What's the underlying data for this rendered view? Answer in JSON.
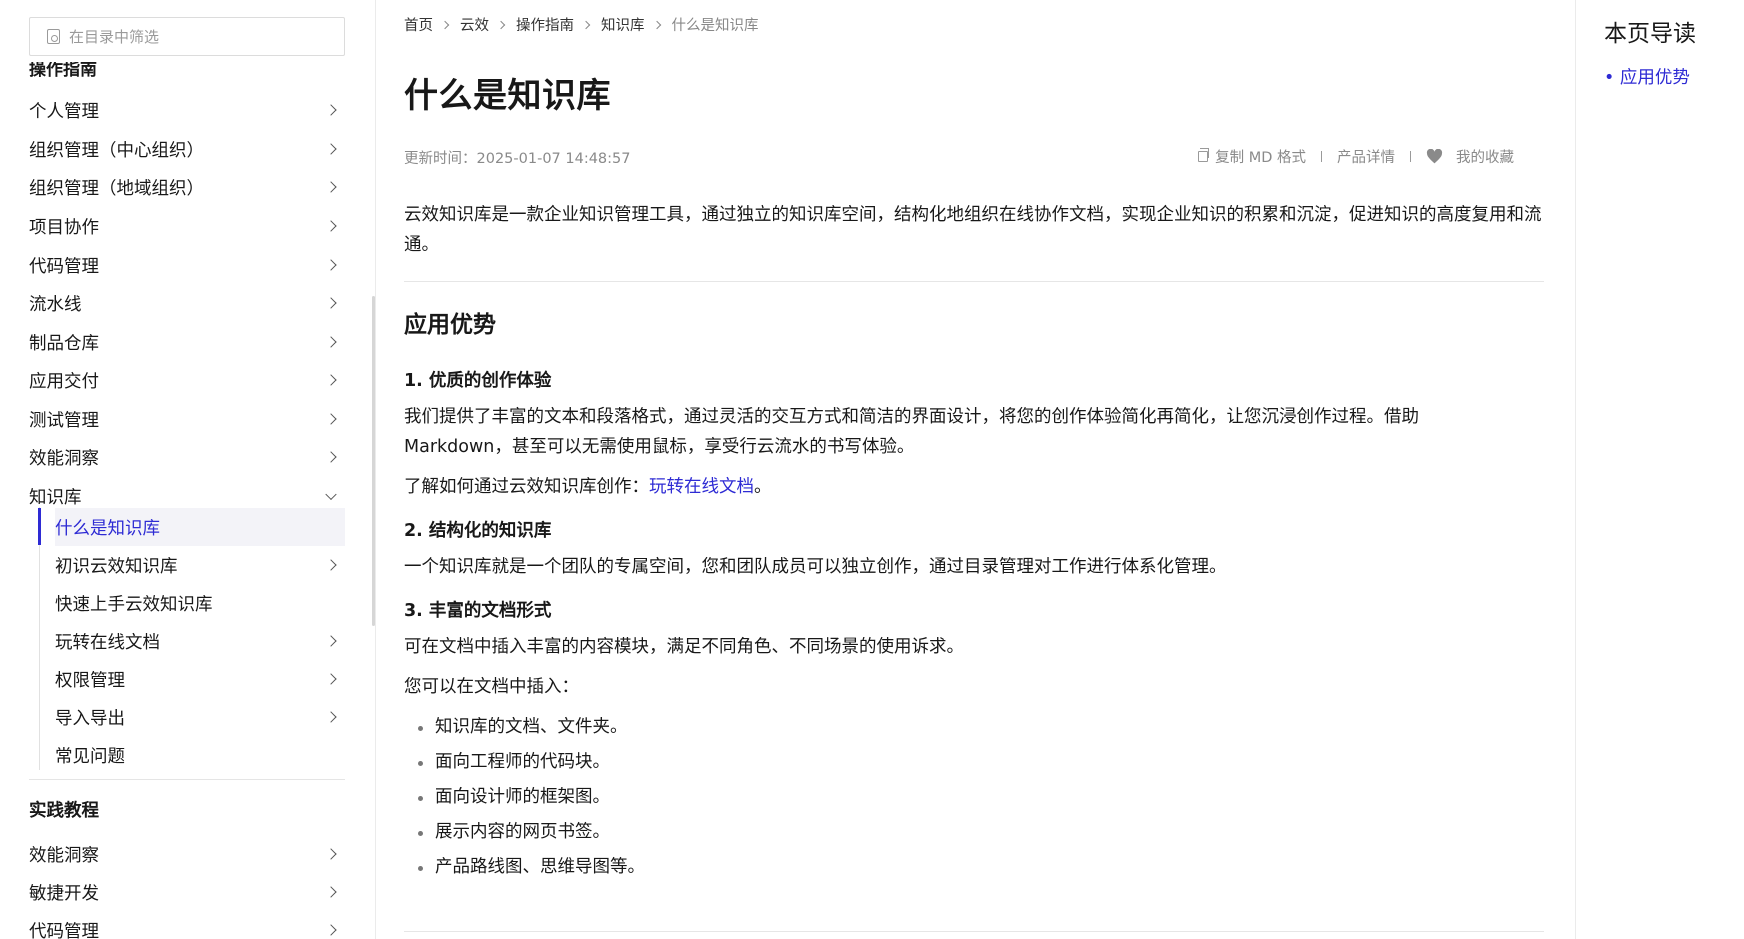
{
  "sidebar": {
    "filter_placeholder": "在目录中筛选",
    "cut_heading": "操作指南",
    "items": [
      {
        "label": "个人管理"
      },
      {
        "label": "组织管理（中心组织）"
      },
      {
        "label": "组织管理（地域组织）"
      },
      {
        "label": "项目协作"
      },
      {
        "label": "代码管理"
      },
      {
        "label": "流水线"
      },
      {
        "label": "制品仓库"
      },
      {
        "label": "应用交付"
      },
      {
        "label": "测试管理"
      },
      {
        "label": "效能洞察"
      },
      {
        "label": "知识库"
      }
    ],
    "sub_items": [
      {
        "label": "什么是知识库"
      },
      {
        "label": "初识云效知识库"
      },
      {
        "label": "快速上手云效知识库"
      },
      {
        "label": "玩转在线文档"
      },
      {
        "label": "权限管理"
      },
      {
        "label": "导入导出"
      },
      {
        "label": "常见问题"
      }
    ],
    "section_heading": "实践教程",
    "practice_items": [
      {
        "label": "效能洞察"
      },
      {
        "label": "敏捷开发"
      },
      {
        "label": "代码管理"
      }
    ]
  },
  "breadcrumb": [
    "首页",
    "云效",
    "操作指南",
    "知识库",
    "什么是知识库"
  ],
  "page_title": "什么是知识库",
  "meta": {
    "updated": "更新时间：2025-01-07 14:48:57",
    "copy_md": "复制 MD 格式",
    "product_detail": "产品详情",
    "favorite": "我的收藏"
  },
  "content": {
    "intro": "云效知识库是一款企业知识管理工具，通过独立的知识库空间，结构化地组织在线协作文档，实现企业知识的积累和沉淀，促进知识的高度复用和流通。",
    "h2": "应用优势",
    "s1_title": "1. 优质的创作体验",
    "s1_p1": "我们提供了丰富的文本和段落格式，通过灵活的交互方式和简洁的界面设计，将您的创作体验简化再简化，让您沉浸创作过程。借助Markdown，甚至可以无需使用鼠标，享受行云流水的书写体验。",
    "s1_p2_prefix": "了解如何通过云效知识库创作：",
    "s1_p2_link": "玩转在线文档",
    "s1_p2_suffix": "。",
    "s2_title": "2. 结构化的知识库",
    "s2_p1": "一个知识库就是一个团队的专属空间，您和团队成员可以独立创作，通过目录管理对工作进行体系化管理。",
    "s3_title": "3. 丰富的文档形式",
    "s3_p1": "可在文档中插入丰富的内容模块，满足不同角色、不同场景的使用诉求。",
    "s3_p2": "您可以在文档中插入：",
    "bullets": [
      "知识库的文档、文件夹。",
      "面向工程师的代码块。",
      "面向设计师的框架图。",
      "展示内容的网页书签。",
      "产品路线图、思维导图等。"
    ]
  },
  "toc": {
    "title": "本页导读",
    "items": [
      "• 应用优势"
    ]
  },
  "colors": {
    "accent": "#2e2bd4",
    "muted": "#8a8a8a",
    "text": "#181818"
  }
}
